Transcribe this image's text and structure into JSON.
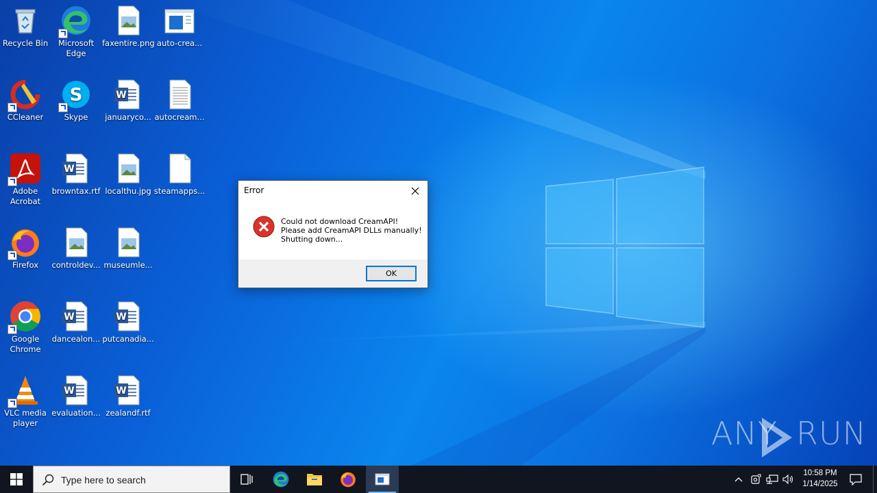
{
  "desktop": {
    "icons": [
      {
        "label": "Recycle Bin",
        "icon": "recycle-bin-icon"
      },
      {
        "label": "Microsoft Edge",
        "icon": "edge-icon"
      },
      {
        "label": "faxentire.png",
        "icon": "image-file-icon"
      },
      {
        "label": "auto-crea...",
        "icon": "window-file-icon"
      },
      {
        "label": "CCleaner",
        "icon": "ccleaner-icon"
      },
      {
        "label": "Skype",
        "icon": "skype-icon"
      },
      {
        "label": "januaryco...",
        "icon": "word-doc-icon"
      },
      {
        "label": "autocream...",
        "icon": "text-file-icon"
      },
      {
        "label": "Adobe Acrobat",
        "icon": "acrobat-icon"
      },
      {
        "label": "browntax.rtf",
        "icon": "word-doc-icon"
      },
      {
        "label": "localthu.jpg",
        "icon": "image-file-icon"
      },
      {
        "label": "steamapps...",
        "icon": "blank-file-icon"
      },
      {
        "label": "Firefox",
        "icon": "firefox-icon"
      },
      {
        "label": "controldev...",
        "icon": "image-file-icon"
      },
      {
        "label": "museumle...",
        "icon": "image-file-icon"
      },
      {
        "label": "Google Chrome",
        "icon": "chrome-icon"
      },
      {
        "label": "dancealon...",
        "icon": "word-doc-icon"
      },
      {
        "label": "putcanadia...",
        "icon": "word-doc-icon"
      },
      {
        "label": "VLC media player",
        "icon": "vlc-icon"
      },
      {
        "label": "evaluation...",
        "icon": "word-doc-icon"
      },
      {
        "label": "zealandf.rtf",
        "icon": "word-doc-icon"
      }
    ],
    "watermark": {
      "left": "ANY",
      "right": "RUN"
    }
  },
  "dialog": {
    "title": "Error",
    "lines": [
      "Could not download CreamAPI!",
      "Please add CreamAPI DLLs manually!",
      "Shutting down..."
    ],
    "ok_label": "OK",
    "icon": "error-icon"
  },
  "taskbar": {
    "search_placeholder": "Type here to search",
    "apps": [
      "task-view-icon",
      "edge-icon",
      "file-explorer-icon",
      "firefox-icon",
      "app-window-icon"
    ],
    "clock_time": "10:58 PM",
    "clock_date": "1/14/2025"
  },
  "colors": {
    "accent": "#0078d7",
    "taskbar": "#101520",
    "error": "#d9342b"
  }
}
